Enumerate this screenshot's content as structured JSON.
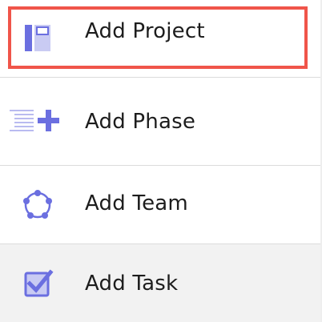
{
  "menu": {
    "items": [
      {
        "label": "Add Project",
        "icon": "project-board-icon",
        "selected": true
      },
      {
        "label": "Add Phase",
        "icon": "phase-list-plus-icon"
      },
      {
        "label": "Add Team",
        "icon": "team-circle-icon"
      },
      {
        "label": "Add Task",
        "icon": "task-checkbox-icon"
      }
    ]
  },
  "colors": {
    "accent": "#6b6fe0",
    "accent_light": "#c9cbf3",
    "highlight_border": "#f0554a",
    "text": "#1d1d1d",
    "hover_row": "#f2f2f2"
  }
}
